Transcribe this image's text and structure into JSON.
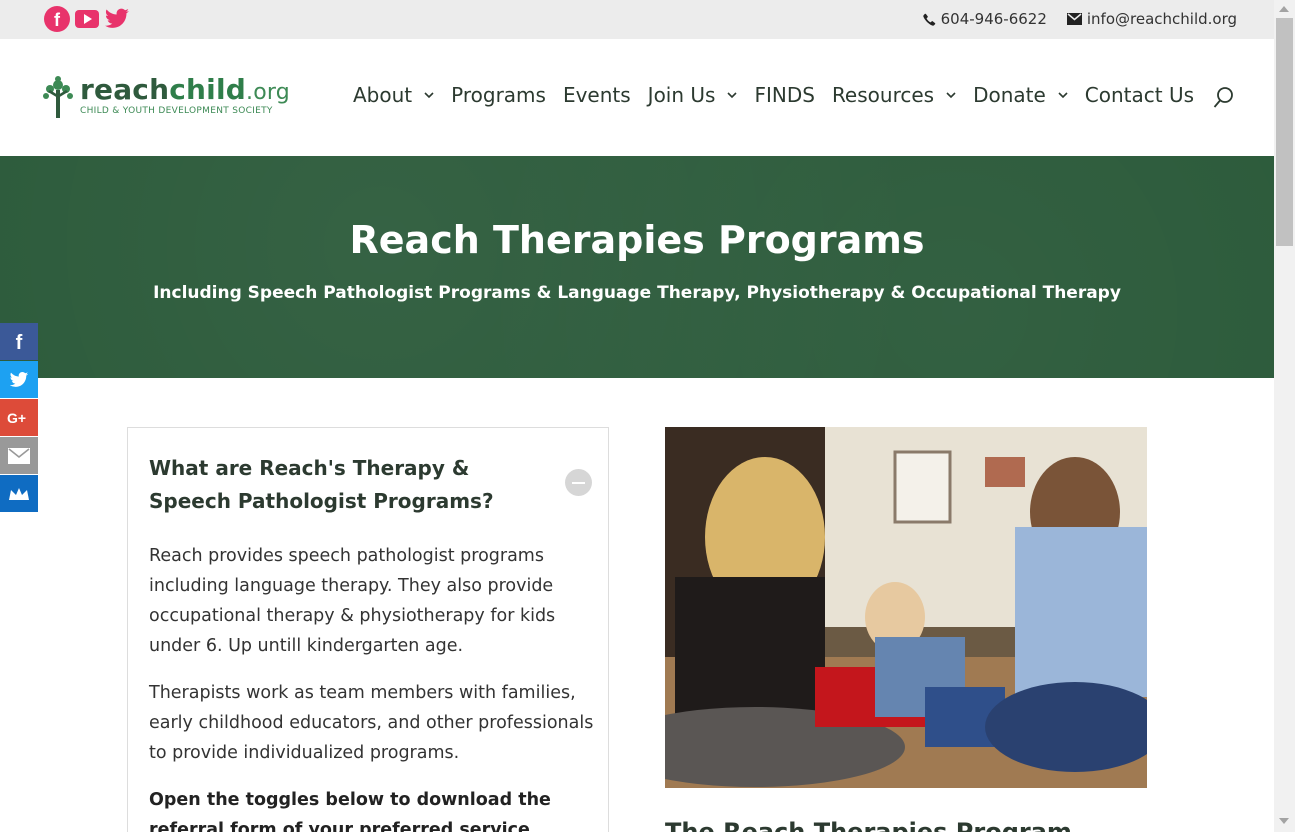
{
  "topbar": {
    "social": [
      "facebook-icon",
      "youtube-icon",
      "twitter-icon"
    ],
    "phone": "604-946-6622",
    "email": "info@reachchild.org"
  },
  "logo": {
    "reach": "reach",
    "child": "child",
    "org": ".org",
    "tagline": "CHILD & YOUTH DEVELOPMENT SOCIETY"
  },
  "nav": {
    "items": [
      {
        "label": "About",
        "has_dropdown": true
      },
      {
        "label": "Programs",
        "has_dropdown": false
      },
      {
        "label": "Events",
        "has_dropdown": false
      },
      {
        "label": "Join Us",
        "has_dropdown": true
      },
      {
        "label": "FINDS",
        "has_dropdown": false
      },
      {
        "label": "Resources",
        "has_dropdown": true
      },
      {
        "label": "Donate",
        "has_dropdown": true
      },
      {
        "label": "Contact Us",
        "has_dropdown": false
      }
    ]
  },
  "hero": {
    "title": "Reach Therapies Programs",
    "subtitle": "Including Speech Pathologist Programs & Language Therapy, Physiotherapy & Occupational Therapy"
  },
  "share": [
    "facebook-icon",
    "twitter-icon",
    "google-plus-icon",
    "email-icon",
    "sumo-crown-icon"
  ],
  "toggle": {
    "title": "What are Reach's Therapy & Speech Pathologist Programs?",
    "p1": "Reach provides speech pathologist programs including language therapy. They also provide occupational therapy & physiotherapy for kids under 6. Up untill kindergarten age.",
    "p2": "Therapists work as team members with families, early childhood educators, and other professionals to provide individualized programs.",
    "p3": "Open the toggles below to download the referral form of your preferred service"
  },
  "photo_below_heading": "The Reach Therapies Program",
  "colors": {
    "brand_green": "#2b5a3a",
    "social_pink": "#e8336b",
    "facebook": "#3b5998",
    "twitter": "#1da1f2",
    "google_plus": "#dd4b39",
    "email": "#888888",
    "sumo": "#0f6cc2"
  }
}
